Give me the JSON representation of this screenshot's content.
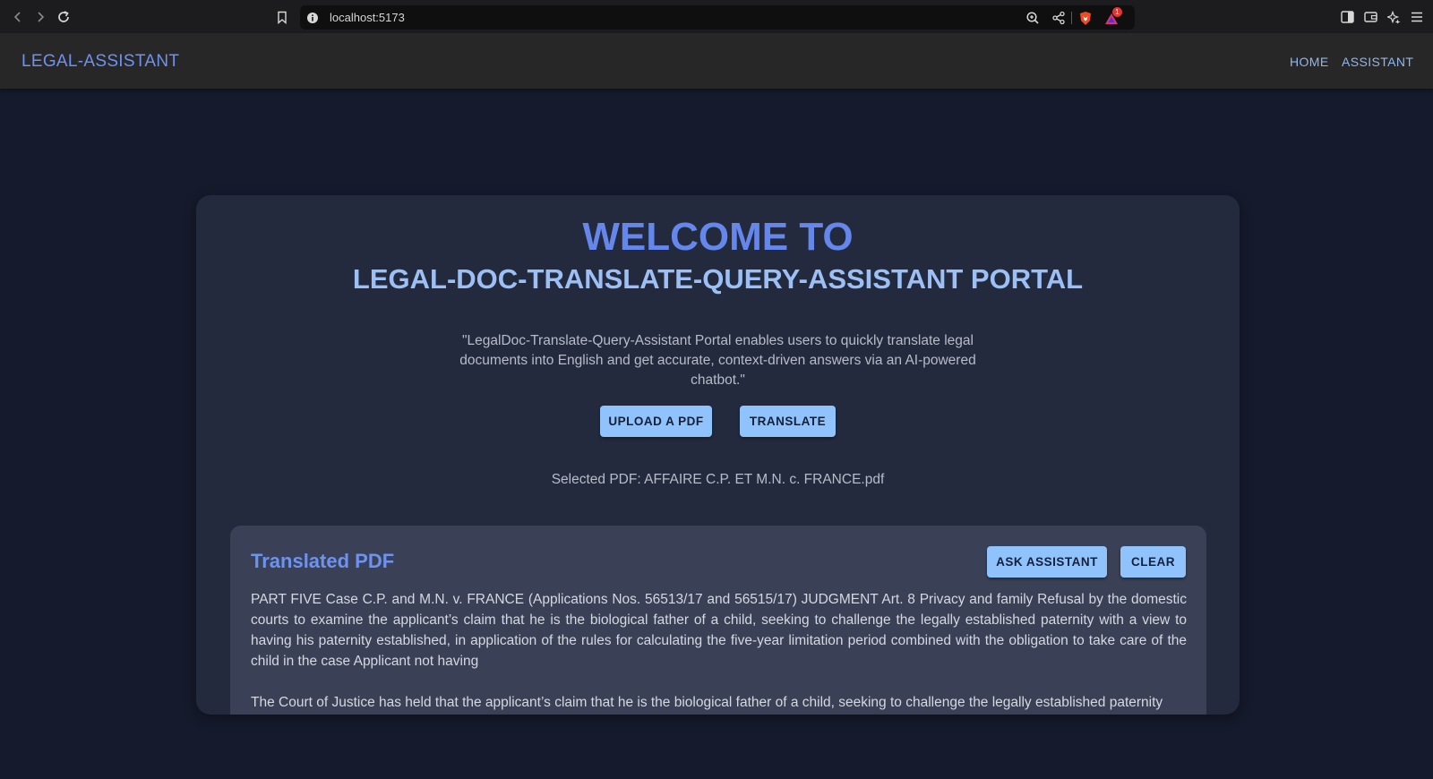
{
  "browser": {
    "url": "localhost:5173",
    "notification_count": "1"
  },
  "header": {
    "logo": "LEGAL-ASSISTANT",
    "nav": [
      "HOME",
      "ASSISTANT"
    ]
  },
  "hero": {
    "welcome": "WELCOME TO",
    "title": "LEGAL-DOC-TRANSLATE-QUERY-ASSISTANT PORTAL",
    "tagline": "\"LegalDoc-Translate-Query-Assistant Portal enables users to quickly translate legal documents into English and get accurate, context-driven answers via an AI-powered chatbot.\""
  },
  "actions": {
    "upload_label": "UPLOAD A PDF",
    "translate_label": "TRANSLATE"
  },
  "selected_pdf": "Selected PDF: AFFAIRE C.P. ET M.N. c. FRANCE.pdf",
  "translated": {
    "title": "Translated PDF",
    "ask_label": "ASK ASSISTANT",
    "clear_label": "CLEAR",
    "paragraphs": [
      "PART FIVE Case C.P. and M.N. v. FRANCE (Applications Nos. 56513/17 and 56515/17) JUDGMENT Art. 8 Privacy and family Refusal by the domestic courts to examine the applicant’s claim that he is the biological father of a child, seeking to challenge the legally established paternity with a view to having his paternity established, in application of the rules for calculating the five-year limitation period combined with the obligation to take care of the child in the case Applicant not having",
      "The Court of Justice has held that the applicant’s claim that he is the biological father of a child, seeking to challenge the legally established paternity"
    ]
  }
}
